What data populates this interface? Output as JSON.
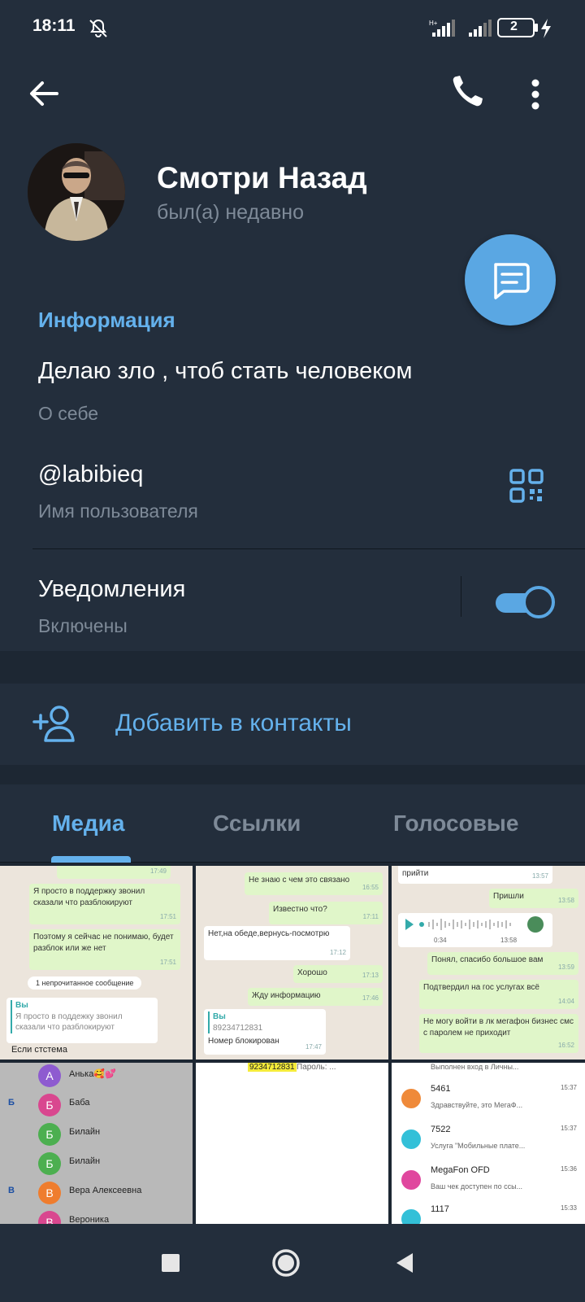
{
  "status_bar": {
    "time": "18:11",
    "battery": "2",
    "icons": [
      "dnd-off-icon",
      "signal-icon",
      "signal-icon",
      "battery-icon",
      "charging-icon"
    ]
  },
  "toolbar": {
    "back_icon": "arrow-left-icon",
    "call_icon": "phone-icon",
    "more_icon": "more-vertical-icon"
  },
  "profile": {
    "name": "Смотри Назад",
    "status": "был(а) недавно"
  },
  "info": {
    "title": "Информация",
    "bio": "Делаю зло , чтоб стать человеком",
    "bio_label": "О себе",
    "username": "@labibieq",
    "username_label": "Имя пользователя",
    "notifications_title": "Уведомления",
    "notifications_state": "Включены",
    "notifications_on": true
  },
  "add_contact": {
    "label": "Добавить в контакты"
  },
  "tabs": [
    {
      "label": "Медиа",
      "active": true
    },
    {
      "label": "Ссылки",
      "active": false
    },
    {
      "label": "Голосовые",
      "active": false
    }
  ],
  "colors": {
    "background": "#1d2733",
    "surface": "#232e3c",
    "accent": "#64b1ec",
    "fab": "#5aa7e3",
    "secondary_text": "#7e8a98"
  },
  "media": {
    "t1": {
      "time_top": "17:49",
      "msg1": "Я просто в поддержку звонил сказали что разблокируют",
      "msg1_time": "17:51",
      "msg2": "Поэтому я сейчас не понимаю, будет разблок или же нет",
      "msg2_time": "17:51",
      "sys": "1 непрочитанное сообщение",
      "reply_from": "Вы",
      "reply_text": "Я просто в поддежку звонил сказали что разблокируют",
      "msg3": "Если стстема"
    },
    "t2": {
      "msg1": "Не знаю с чем это связано",
      "msg1_time": "16:55",
      "msg2": "Известно что?",
      "msg2_time": "17:11",
      "msg3": "Нет,на обеде,вернусь-посмотрю",
      "msg3_time": "17:12",
      "msg4": "Хорошо",
      "msg4_time": "17:13",
      "msg5": "Жду информацию",
      "msg5_time": "17:46",
      "reply_from": "Вы",
      "reply_text": "89234712831",
      "msg6": "Номер блокирован",
      "msg6_time": "17:47"
    },
    "t3": {
      "msg1": "прийти",
      "msg1_time": "13:57",
      "msg2": "Пришли",
      "msg2_time": "13:58",
      "voice_duration": "0:34",
      "voice_time": "13:58",
      "msg3": "Понял, спасибо большое вам",
      "msg3_time": "13:59",
      "msg4": "Подтвердил на гос услугах всё",
      "msg4_time": "14:04",
      "msg5": "Не могу войти в лк мегафон бизнес смс с паролем не приходит",
      "msg5_time": "16:52"
    },
    "t4": {
      "contacts": [
        {
          "letter": "",
          "initial": "А",
          "name": "Анька🥰💕",
          "color": "#8e5bd0"
        },
        {
          "letter": "Б",
          "initial": "Б",
          "name": "Баба",
          "color": "#d9478f"
        },
        {
          "letter": "",
          "initial": "Б",
          "name": "Билайн",
          "color": "#4caf50"
        },
        {
          "letter": "",
          "initial": "Б",
          "name": "Билайн",
          "color": "#4caf50"
        },
        {
          "letter": "В",
          "initial": "В",
          "name": "Вера Алексеевна",
          "color": "#ef7d2e"
        },
        {
          "letter": "",
          "initial": "В",
          "name": "Вероника",
          "color": "#d9478f"
        }
      ]
    },
    "t5": {
      "highlight": "9234712831",
      "text": "Пароль: ..."
    },
    "t6": {
      "header": "Выполнен вход в Личны...",
      "items": [
        {
          "name": "5461",
          "preview": "Здравствуйте, это МегаФ...",
          "time": "15:37",
          "color": "#ef8a3a"
        },
        {
          "name": "7522",
          "preview": "Услуга \"Мобильные плате...",
          "time": "15:37",
          "color": "#33c0d8"
        },
        {
          "name": "MegaFon OFD",
          "preview": "Ваш чек доступен по ссы...",
          "time": "15:36",
          "color": "#e0479e"
        },
        {
          "name": "1117",
          "preview": "",
          "time": "15:33",
          "color": "#33c0d8"
        }
      ]
    }
  },
  "nav": {
    "recents_icon": "square-icon",
    "home_icon": "circle-icon",
    "back_icon": "triangle-back-icon"
  }
}
